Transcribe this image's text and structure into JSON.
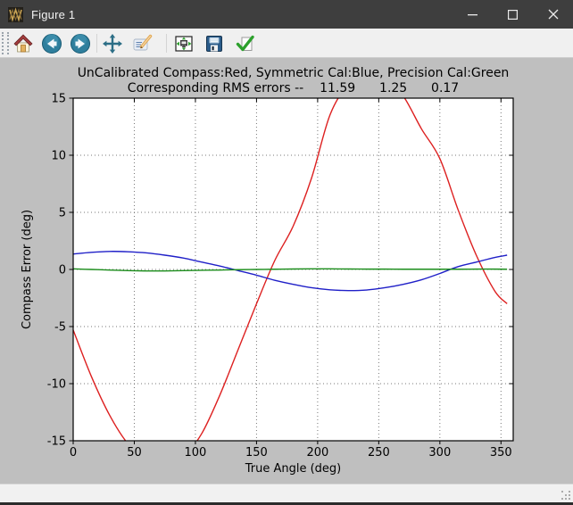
{
  "window": {
    "title": "Figure 1"
  },
  "toolbar": {
    "icons": [
      "home-icon",
      "back-icon",
      "forward-icon",
      "pan-icon",
      "edit-icon",
      "configure-subplots-icon",
      "save-icon",
      "confirm-icon"
    ]
  },
  "figure": {
    "title_line1": "UnCalibrated Compass:Red, Symmetric Cal:Blue, Precision Cal:Green",
    "rms_label": "Corresponding RMS errors --",
    "rms_values": [
      "11.59",
      "1.25",
      "0.17"
    ]
  },
  "chart_data": {
    "type": "line",
    "title": "UnCalibrated Compass:Red, Symmetric Cal:Blue, Precision Cal:Green",
    "subtitle": "Corresponding RMS errors -- 11.59 1.25 0.17",
    "xlabel": "True Angle (deg)",
    "ylabel": "Compass Error (deg)",
    "xlim": [
      0,
      360
    ],
    "ylim": [
      -15,
      15
    ],
    "xticks": [
      0,
      50,
      100,
      150,
      200,
      250,
      300,
      350
    ],
    "yticks": [
      15,
      10,
      5,
      0,
      -5,
      -10,
      -15
    ],
    "grid": "dotted",
    "legend_position": "none",
    "x": [
      0,
      15,
      30,
      45,
      60,
      75,
      90,
      105,
      120,
      135,
      150,
      165,
      180,
      195,
      210,
      225,
      240,
      255,
      270,
      285,
      300,
      315,
      330,
      345,
      355
    ],
    "series": [
      {
        "name": "UnCalibrated Compass",
        "color": "#dd2020",
        "rms": 11.59,
        "values": [
          -5.3,
          -9.4,
          -12.8,
          -15.3,
          -16.8,
          -17.2,
          -16.4,
          -14.4,
          -11.0,
          -7.0,
          -3.0,
          0.8,
          3.8,
          8.0,
          13.5,
          16.2,
          17.4,
          16.9,
          15.2,
          12.3,
          9.7,
          5.2,
          1.2,
          -1.9,
          -3.0
        ]
      },
      {
        "name": "Symmetric Cal",
        "color": "#2020c8",
        "rms": 1.25,
        "values": [
          1.35,
          1.5,
          1.58,
          1.55,
          1.45,
          1.25,
          1.0,
          0.65,
          0.3,
          -0.1,
          -0.5,
          -0.95,
          -1.3,
          -1.6,
          -1.78,
          -1.85,
          -1.8,
          -1.6,
          -1.3,
          -0.9,
          -0.35,
          0.25,
          0.65,
          1.05,
          1.25
        ]
      },
      {
        "name": "Precision Cal",
        "color": "#1a8c1a",
        "rms": 0.17,
        "values": [
          0.05,
          0.0,
          -0.05,
          -0.1,
          -0.13,
          -0.13,
          -0.1,
          -0.07,
          -0.05,
          -0.02,
          0.0,
          0.02,
          0.04,
          0.05,
          0.05,
          0.04,
          0.03,
          0.03,
          0.02,
          0.02,
          0.02,
          0.02,
          0.03,
          0.03,
          0.02
        ]
      }
    ],
    "colors": {
      "figure_bg": "#bfbfbf",
      "axes_bg": "#ffffff",
      "grid": "#777777"
    }
  }
}
